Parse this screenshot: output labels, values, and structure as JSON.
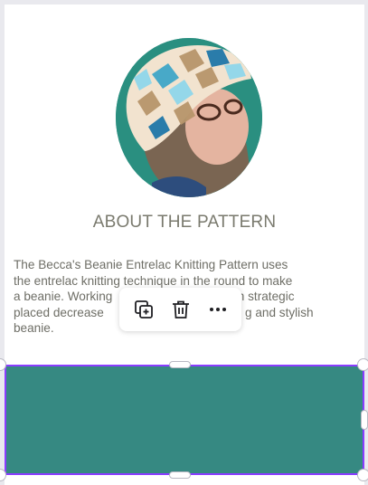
{
  "section": {
    "heading": "ABOUT THE PATTERN",
    "description_visible_lines": [
      "The Becca's Beanie Entrelac Knitting Pattern uses",
      "the entrelac knitting technique in the round to make",
      "a beanie. Working",
      "ith strategic",
      "placed decrease",
      "g and stylish",
      "beanie."
    ]
  },
  "toolbar": {
    "icons": [
      "duplicate-icon",
      "trash-icon",
      "more-options-icon"
    ]
  },
  "colors": {
    "banner": "#368982",
    "selection": "#8b3dff",
    "text": "#6e6e66",
    "heading": "#7a7a6e",
    "avatar_bg": "#2a8f80"
  }
}
